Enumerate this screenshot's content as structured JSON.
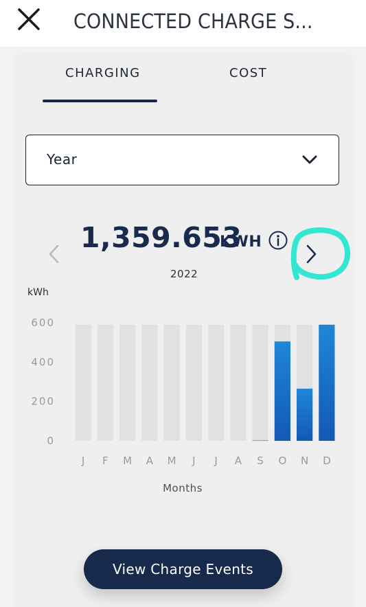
{
  "header": {
    "title": "CONNECTED CHARGE S...",
    "close_icon": "close-icon"
  },
  "tabs": [
    {
      "label": "CHARGING",
      "active": true
    },
    {
      "label": "COST",
      "active": false
    }
  ],
  "period_select": {
    "value": "Year",
    "icon": "chevron-down-icon"
  },
  "summary": {
    "total": "1,359.653",
    "unit": "KWH",
    "year": "2022",
    "info_icon": "info-icon",
    "prev_icon": "chevron-left-icon",
    "next_icon": "chevron-right-icon",
    "highlight_color": "#33e6d2"
  },
  "chart_data": {
    "type": "bar",
    "ylabel": "kWh",
    "xlabel": "Months",
    "ylim": [
      0,
      600
    ],
    "yticks": [
      0,
      200,
      400,
      600
    ],
    "categories": [
      "J",
      "F",
      "M",
      "A",
      "M",
      "J",
      "J",
      "A",
      "S",
      "O",
      "N",
      "D"
    ],
    "values": [
      0,
      0,
      0,
      0,
      0,
      0,
      0,
      0,
      3,
      505,
      265,
      590
    ],
    "background_max": 590,
    "colors": {
      "background_bar": "#e1e1e1",
      "bar_top": "#1f86d8",
      "bar_bottom": "#1459b3",
      "axis_text": "#9a9a9a"
    }
  },
  "actions": {
    "view_events_label": "View Charge Events"
  }
}
